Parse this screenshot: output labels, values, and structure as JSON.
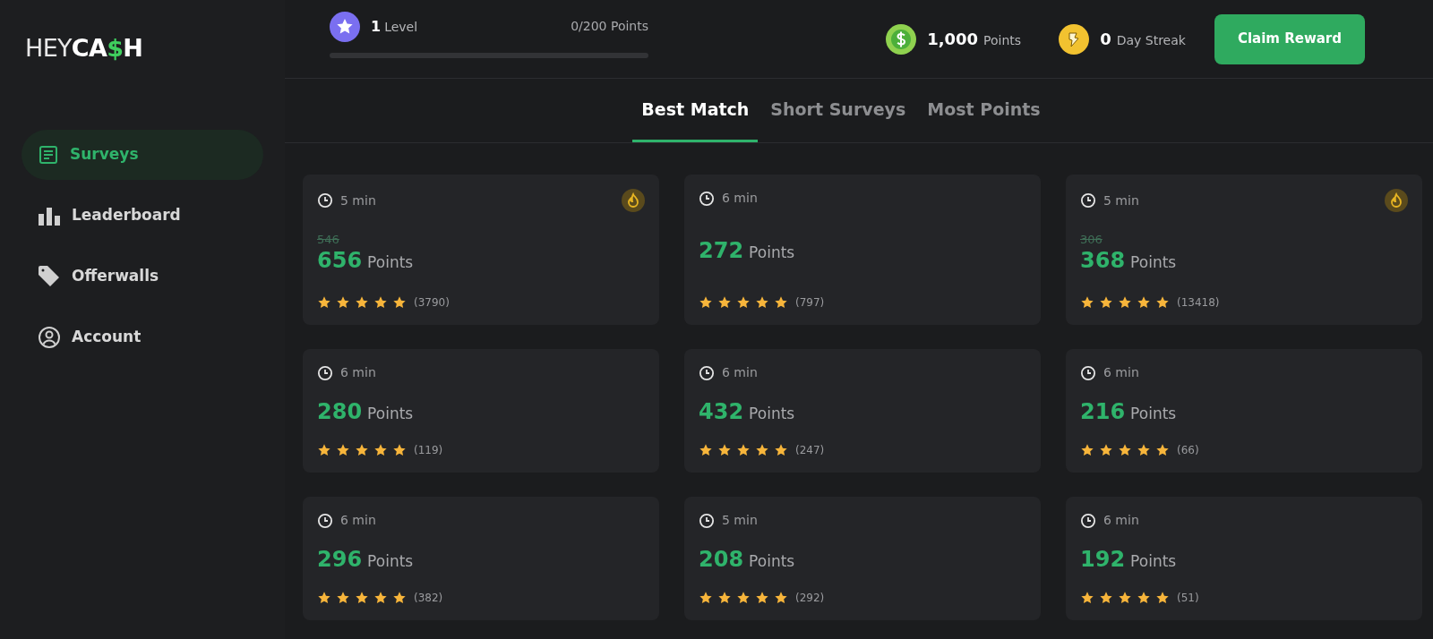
{
  "logo": [
    {
      "text": "HEY",
      "kind": "light"
    },
    {
      "text": "CA",
      "kind": "bold"
    },
    {
      "text": "$",
      "kind": "accent"
    },
    {
      "text": "H",
      "kind": "bold"
    }
  ],
  "sidebar": {
    "items": [
      {
        "label": "Surveys",
        "selected": true
      },
      {
        "label": "Leaderboard",
        "selected": false
      },
      {
        "label": "Offerwalls",
        "selected": false
      },
      {
        "label": "Account",
        "selected": false
      }
    ]
  },
  "header": {
    "level_number": "1",
    "level_label": "Level",
    "progress_text": "0/200 Points",
    "progress": {
      "level": 0
    },
    "balance_value": "1,000",
    "balance_label": "Points",
    "streak_value": "0",
    "streak_label": "Day Streak",
    "claim_button": "Claim Reward"
  },
  "tabs": [
    {
      "label": "Best Match",
      "selected": true
    },
    {
      "label": "Short Surveys",
      "selected": false
    },
    {
      "label": "Most Points",
      "selected": false
    }
  ],
  "surveys": [
    {
      "duration": "5 min",
      "hot": true,
      "old_points": "546",
      "points": "656",
      "points_label": "Points",
      "stars": 5,
      "reviews": "(3790)"
    },
    {
      "duration": "6 min",
      "hot": false,
      "points": "272",
      "points_label": "Points",
      "stars": 5,
      "reviews": "(797)"
    },
    {
      "duration": "5 min",
      "hot": true,
      "old_points": "306",
      "points": "368",
      "points_label": "Points",
      "stars": 5,
      "reviews": "(13418)"
    },
    {
      "duration": "6 min",
      "hot": false,
      "points": "280",
      "points_label": "Points",
      "stars": 5,
      "reviews": "(119)"
    },
    {
      "duration": "6 min",
      "hot": false,
      "points": "432",
      "points_label": "Points",
      "stars": 5,
      "reviews": "(247)"
    },
    {
      "duration": "6 min",
      "hot": false,
      "points": "216",
      "points_label": "Points",
      "stars": 5,
      "reviews": "(66)"
    },
    {
      "duration": "6 min",
      "hot": false,
      "points": "296",
      "points_label": "Points",
      "stars": 5,
      "reviews": "(382)"
    },
    {
      "duration": "5 min",
      "hot": false,
      "points": "208",
      "points_label": "Points",
      "stars": 5,
      "reviews": "(292)"
    },
    {
      "duration": "6 min",
      "hot": false,
      "points": "192",
      "points_label": "Points",
      "stars": 5,
      "reviews": "(51)"
    }
  ]
}
